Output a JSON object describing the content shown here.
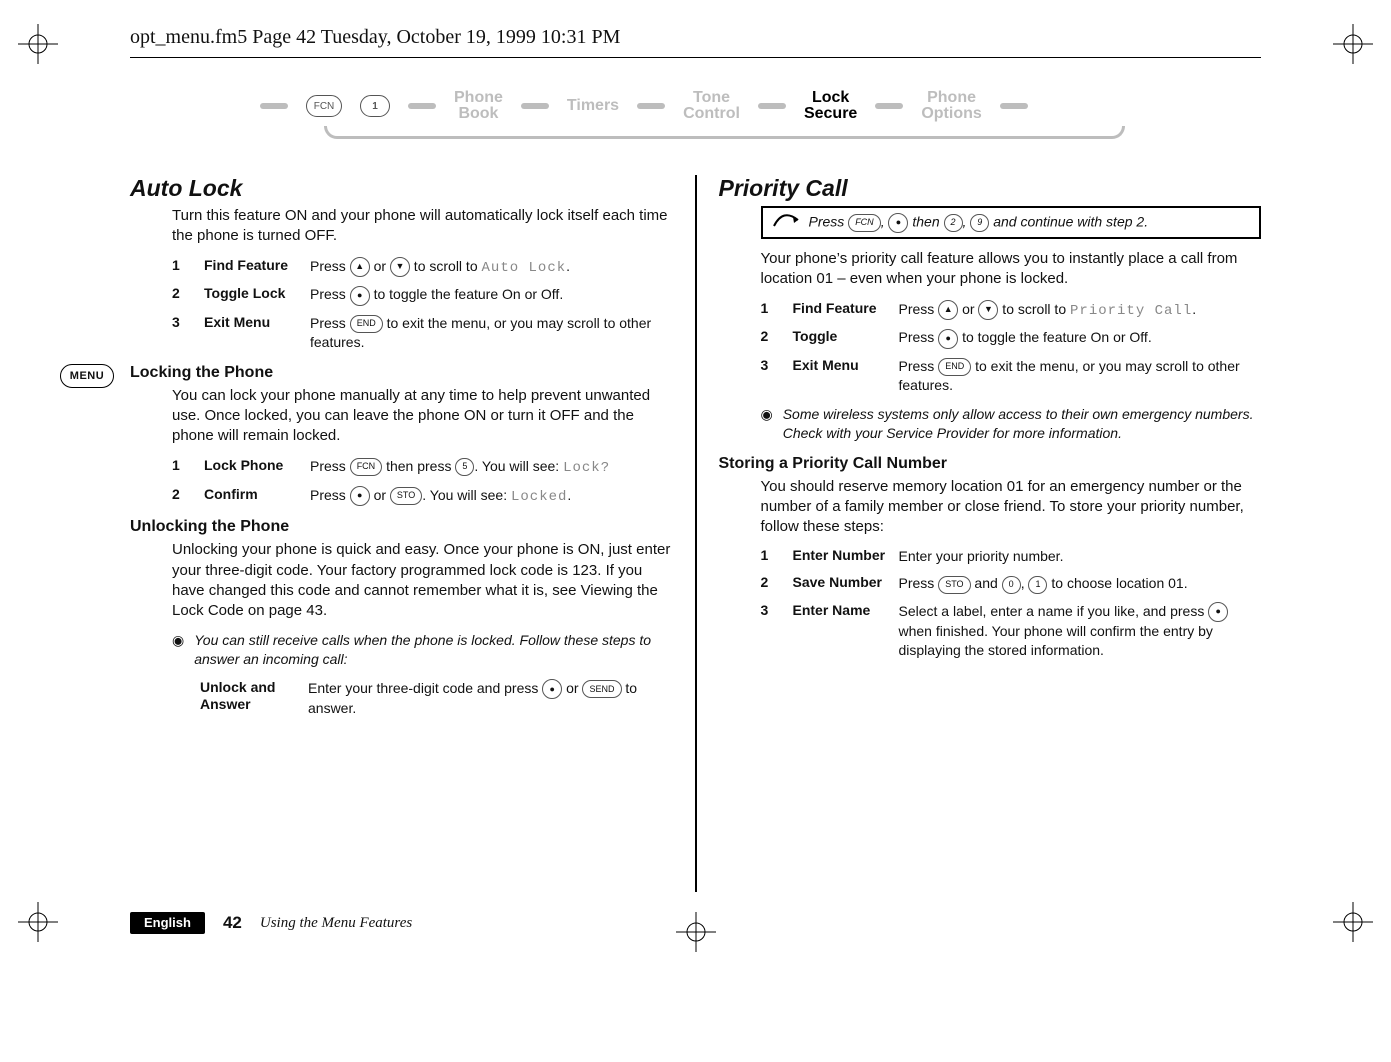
{
  "running_head": "opt_menu.fm5  Page 42  Tuesday, October 19, 1999  10:31 PM",
  "nav": {
    "fcn": "FCN",
    "one": "1",
    "items": [
      {
        "l1": "Phone",
        "l2": "Book",
        "active": false
      },
      {
        "l1": "Timers",
        "l2": "",
        "active": false
      },
      {
        "l1": "Tone",
        "l2": "Control",
        "active": false
      },
      {
        "l1": "Lock",
        "l2": "Secure",
        "active": true
      },
      {
        "l1": "Phone",
        "l2": "Options",
        "active": false
      }
    ]
  },
  "left": {
    "h2": "Auto Lock",
    "intro": "Turn this feature ON and your phone will automatically lock itself each time the phone is turned OFF.",
    "steps1": [
      {
        "n": "1",
        "label": "Find Feature",
        "pre": "Press ",
        "mid": " or ",
        "post": " to scroll to ",
        "lcd": "Auto Lock",
        "tail": "."
      },
      {
        "n": "2",
        "label": "Toggle Lock",
        "pre": "Press ",
        "post": " to toggle the feature On or Off."
      },
      {
        "n": "3",
        "label": "Exit Menu",
        "pre": "Press ",
        "key": "END",
        "post": " to exit the menu, or you may scroll to other features."
      }
    ],
    "menu_badge": "MENU",
    "sub1": "Locking the Phone",
    "sub1_body": "You can lock your phone manually at any time to help prevent unwanted use. Once locked, you can leave the phone ON or turn it OFF and the phone will remain locked.",
    "steps2": [
      {
        "n": "1",
        "label": "Lock Phone",
        "pre": "Press ",
        "key1": "FCN",
        "mid": " then press ",
        "key2": "5",
        "post": ". You will see: ",
        "lcd": "Lock?"
      },
      {
        "n": "2",
        "label": "Confirm",
        "pre": "Press ",
        "mid": " or ",
        "key2": "STO",
        "post": ". You will see: ",
        "lcd": "Locked",
        "tail": "."
      }
    ],
    "sub2": "Unlocking the Phone",
    "sub2_body": "Unlocking your phone is quick and easy. Once your phone is ON, just enter your three-digit code. Your factory programmed lock code is 123. If you have changed this code and cannot remember what it is, see Viewing the Lock Code on page 43.",
    "note": "You can still receive calls when the phone is locked. Follow these steps to answer an incoming call:",
    "unlock_label": "Unlock and Answer",
    "unlock_pre": "Enter your three-digit code and press ",
    "unlock_mid": " or ",
    "unlock_key": "SEND",
    "unlock_post": " to answer."
  },
  "right": {
    "h2": "Priority Call",
    "fast_pre": "Press ",
    "fast_k1": "FCN",
    "fast_mid1": ", ",
    "fast_mid1b": " then ",
    "fast_k2": "2",
    "fast_mid2": ", ",
    "fast_k3": "9",
    "fast_post": " and continue with step 2.",
    "intro": "Your phone’s priority call feature allows you to instantly place a call from location 01 – even when your phone is locked.",
    "steps": [
      {
        "n": "1",
        "label": "Find Feature",
        "pre": "Press ",
        "mid": " or ",
        "post": " to scroll to ",
        "lcd": "Priority Call",
        "tail": "."
      },
      {
        "n": "2",
        "label": "Toggle",
        "pre": "Press ",
        "post": " to toggle the feature On or Off."
      },
      {
        "n": "3",
        "label": "Exit Menu",
        "pre": "Press ",
        "key": "END",
        "post": " to exit the menu, or you may scroll to other features."
      }
    ],
    "note": "Some wireless systems only allow access to their own emergency numbers. Check with your Service Provider for more information.",
    "sub": "Storing a Priority Call Number",
    "sub_body": "You should reserve memory location 01 for an emergency number or the number of a family member or close friend. To store your priority number, follow these steps:",
    "steps2": [
      {
        "n": "1",
        "label": "Enter Number",
        "desc": "Enter your priority number."
      },
      {
        "n": "2",
        "label": "Save Number",
        "pre": "Press ",
        "k1": "STO",
        "mid1": " and ",
        "k2": "0",
        "mid2": ", ",
        "k3": "1",
        "post": " to choose location 01."
      },
      {
        "n": "3",
        "label": "Enter Name",
        "pre": "Select a label, enter a name if you like, and press ",
        "post": " when finished. Your phone will confirm the entry by displaying the stored information."
      }
    ]
  },
  "footer": {
    "lang": "English",
    "page": "42",
    "title": "Using the Menu Features"
  }
}
